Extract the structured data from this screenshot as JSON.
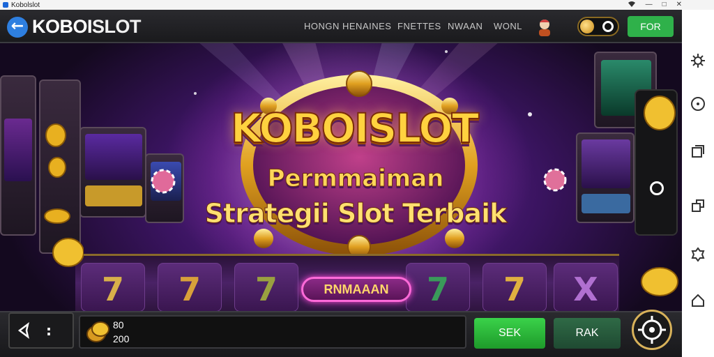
{
  "status_bar": {
    "app_title": "Kobolslot",
    "minimize": "—",
    "maximize": "□",
    "close": "✕"
  },
  "header": {
    "brand_part1": "KOBOI",
    "brand_part2": "SLOT",
    "menu": [
      "HONGN HENAINES",
      "FNETTES",
      "NWAAN",
      "WONL"
    ],
    "cta_label": "FOR"
  },
  "hero": {
    "title": "KOBOISLOT",
    "line2": "Permmaiman",
    "line3": "Strategii Slot Terbaik",
    "play_label": "RNMAAAN"
  },
  "reels": [
    "7",
    "7",
    "7",
    "7",
    "7",
    "X"
  ],
  "bottom": {
    "wallet_line1": "80",
    "wallet_line2": "200",
    "nav_dots": ":",
    "btn_primary": "SEK",
    "btn_secondary": "RAK"
  },
  "icons": [
    "back-arrow-icon",
    "avatar-icon",
    "coin-icon",
    "spin-target-icon",
    "settings-icon",
    "compass-icon",
    "windows-icon",
    "resize-icon",
    "gear-icon",
    "home-icon"
  ],
  "colors": {
    "accent_blue": "#2e7fe0",
    "accent_green": "#2fb14a",
    "gold": "#ffd23f",
    "purple": "#6d2a9c"
  }
}
